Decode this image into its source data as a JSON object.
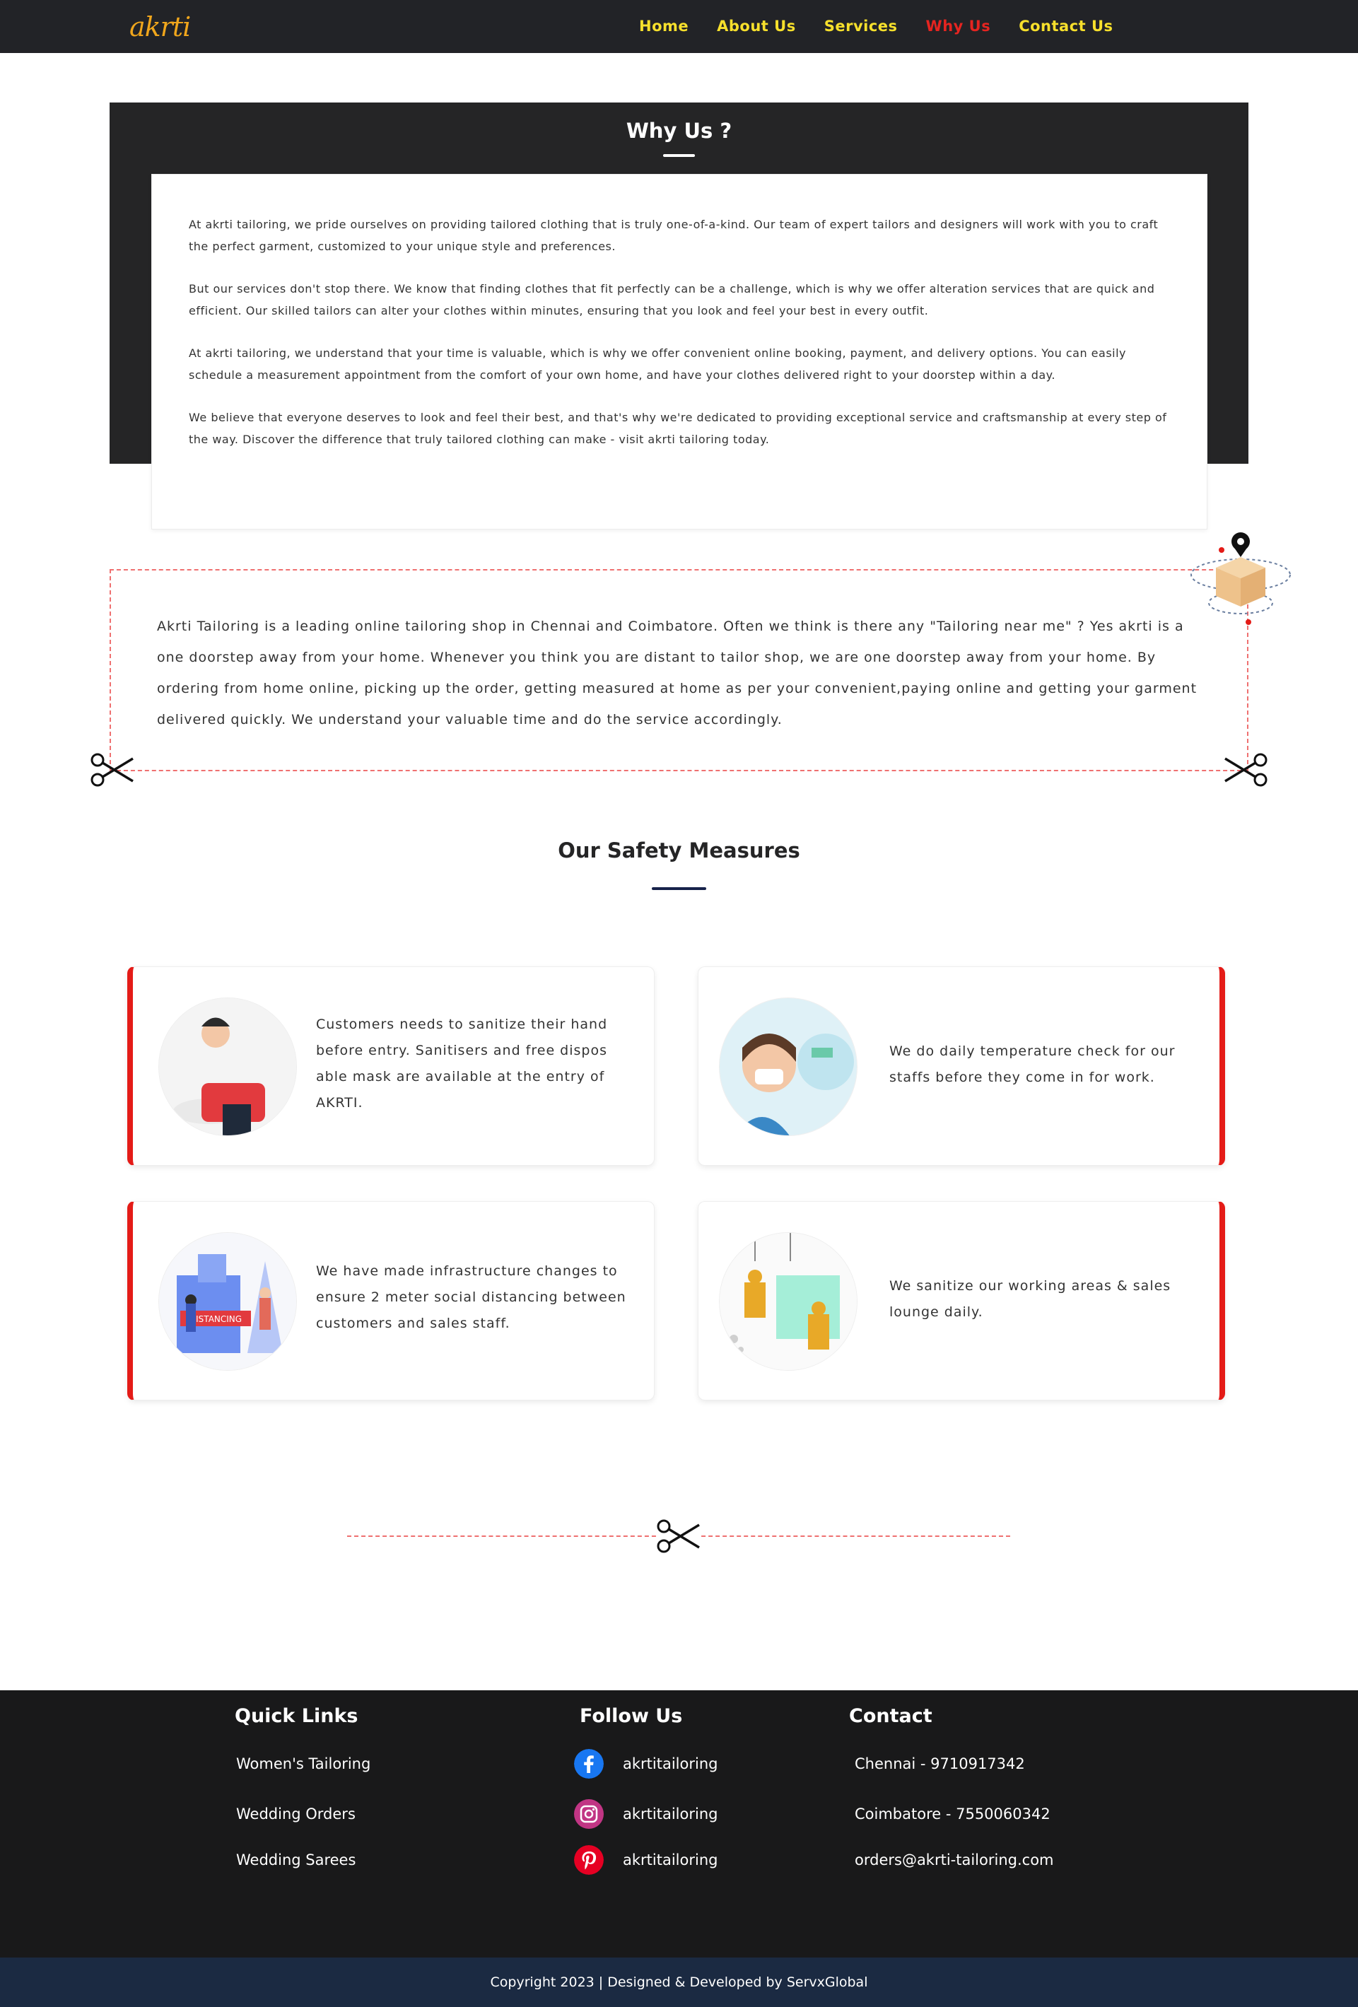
{
  "nav": {
    "logo": "akrti",
    "items": [
      {
        "label": "Home",
        "active": false
      },
      {
        "label": "About Us",
        "active": false
      },
      {
        "label": "Services",
        "active": false
      },
      {
        "label": "Why Us",
        "active": true
      },
      {
        "label": "Contact Us",
        "active": false
      }
    ]
  },
  "why": {
    "title": "Why Us ?",
    "paragraphs": [
      "At akrti tailoring, we pride ourselves on providing tailored clothing that is truly one-of-a-kind. Our team of expert tailors and designers will work with you to craft the perfect garment, customized to your unique style and preferences.",
      "But our services don't stop there. We know that finding clothes that fit perfectly can be a challenge, which is why we offer alteration services that are quick and efficient. Our skilled tailors can alter your clothes within minutes, ensuring that you look and feel your best in every outfit.",
      "At akrti tailoring, we understand that your time is valuable, which is why we offer convenient online booking, payment, and delivery options. You can easily schedule a measurement appointment from the comfort of your own home, and have your clothes delivered right to your doorstep within a day.",
      "We believe that everyone deserves to look and feel their best, and that's why we're dedicated to providing exceptional service and craftsmanship at every step of the way. Discover the difference that truly tailored clothing can make - visit akrti tailoring today."
    ]
  },
  "intro": {
    "text": "Akrti Tailoring is a leading online tailoring shop in Chennai and Coimbatore. Often we think is there any \"Tailoring near me\" ?  Yes akrti is a one doorstep away from your home. Whenever you think you are distant to tailor shop, we are one doorstep away from your home. By ordering from home online, picking up the order, getting measured at home as per your convenient,paying online and getting your garment delivered quickly. We understand your valuable time and do the service accordingly."
  },
  "safety": {
    "title": "Our Safety Measures",
    "cards": [
      {
        "text": "Customers needs to sanitize their hand before entry. Sanitisers and free dispos able mask are available at the entry of AKRTI.",
        "icon": "hand-washing-illustration"
      },
      {
        "text": "We do daily temperature check for our staffs before they come in for work.",
        "icon": "temperature-check-illustration"
      },
      {
        "text": "We have made infrastructure changes to ensure 2 meter social distancing between customers and sales staff.",
        "icon": "social-distancing-illustration",
        "badge": "DISTANCING"
      },
      {
        "text": "We sanitize our working areas & sales lounge daily.",
        "icon": "sanitizing-illustration"
      }
    ]
  },
  "footer": {
    "quick_links_title": "Quick Links",
    "quick_links": [
      "Women's Tailoring",
      "Wedding Orders",
      "Wedding Sarees"
    ],
    "follow_title": "Follow Us",
    "social": [
      {
        "network": "facebook",
        "handle": "akrtitailoring",
        "color": "#1877f2"
      },
      {
        "network": "instagram",
        "handle": "akrtitailoring",
        "color": "#c13584"
      },
      {
        "network": "pinterest",
        "handle": "akrtitailoring",
        "color": "#e60023"
      }
    ],
    "contact_title": "Contact",
    "contacts": [
      "Chennai - 9710917342",
      "Coimbatore - 7550060342",
      "orders@akrti-tailoring.com"
    ],
    "copyright": "Copyright 2023 | Designed & Developed by ServxGlobal"
  },
  "colors": {
    "nav_bg": "#222327",
    "nav_text": "#f7e02c",
    "nav_active": "#e52420",
    "accent_red": "#e41b17",
    "footer_bg": "#19191a",
    "copyright_bg": "#1b2a42"
  }
}
